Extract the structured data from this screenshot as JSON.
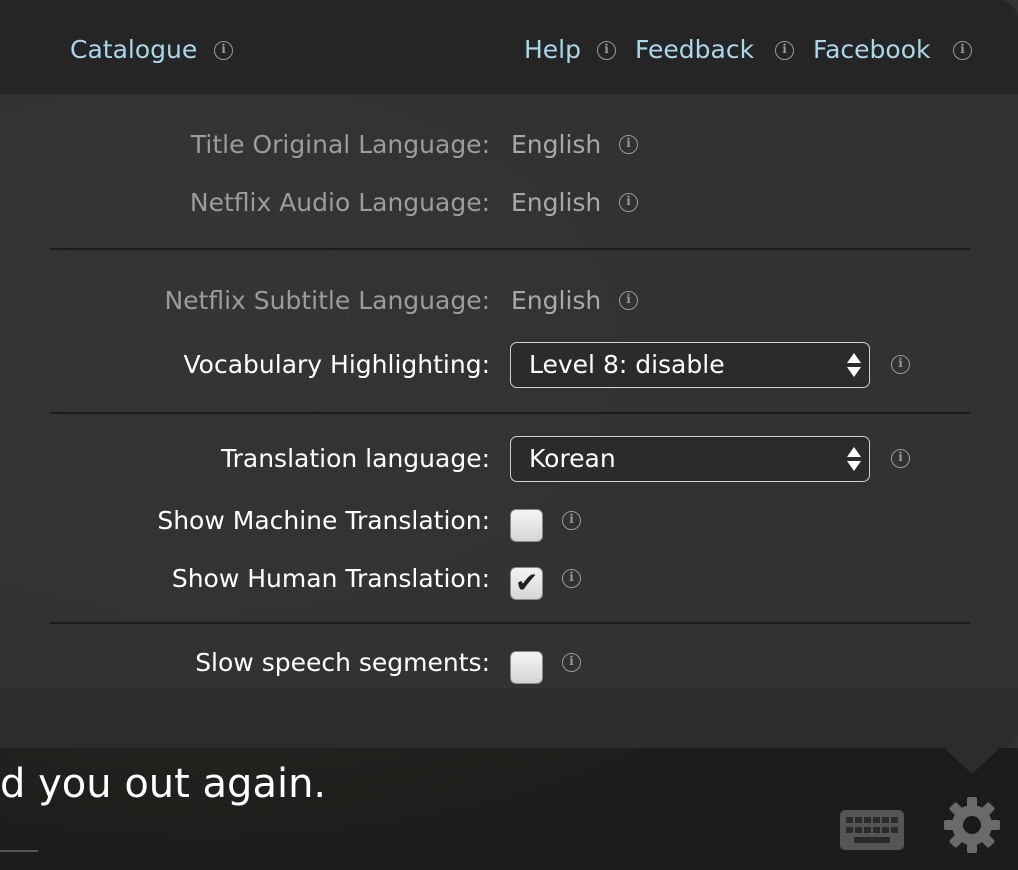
{
  "header": {
    "catalogue": "Catalogue",
    "help": "Help",
    "feedback": "Feedback",
    "facebook": "Facebook"
  },
  "settings": {
    "title_original_language": {
      "label": "Title Original Language:",
      "value": "English"
    },
    "netflix_audio_language": {
      "label": "Netflix Audio Language:",
      "value": "English"
    },
    "netflix_subtitle_language": {
      "label": "Netflix Subtitle Language:",
      "value": "English"
    },
    "vocabulary_highlighting": {
      "label": "Vocabulary Highlighting:",
      "selected": "Level 8: disable"
    },
    "translation_language": {
      "label": "Translation language:",
      "selected": "Korean"
    },
    "show_machine_translation": {
      "label": "Show Machine Translation:",
      "checked": false
    },
    "show_human_translation": {
      "label": "Show Human Translation:",
      "checked": true
    },
    "slow_speech_segments": {
      "label": "Slow speech segments:",
      "checked": false
    }
  },
  "subtitle": {
    "text": "d you out again."
  },
  "icons": {
    "info": "info-icon",
    "keyboard": "keyboard-icon",
    "settings": "gear-icon"
  },
  "colors": {
    "link": "#a9d7ec",
    "panel": "#343434",
    "header": "#242424"
  }
}
